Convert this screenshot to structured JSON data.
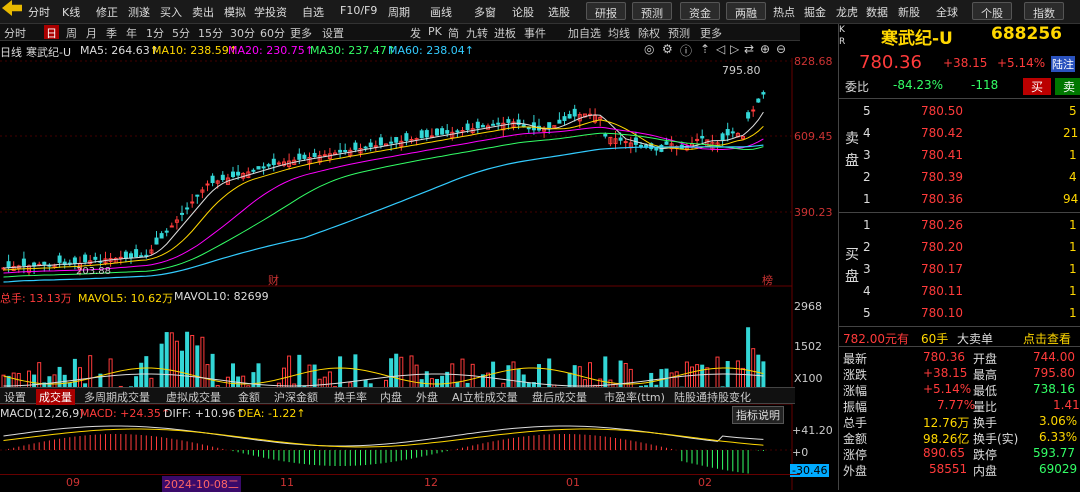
{
  "toolbar": {
    "left_items": [
      "分时",
      "K线",
      "修正",
      "测遂",
      "买入",
      "卖出",
      "模拟",
      "学投资",
      "自选",
      "F10/F9",
      "周期",
      "画线",
      "多窗",
      "论股",
      "选股"
    ],
    "right_buttons": [
      "研报",
      "预测",
      "资金",
      "两融"
    ],
    "right_items": [
      "热点",
      "掘金",
      "龙虎",
      "数据",
      "新股",
      "全球"
    ],
    "far_right_buttons": [
      "个股",
      "指数"
    ]
  },
  "periods": {
    "items": [
      "分时",
      "日",
      "周",
      "月",
      "季",
      "年",
      "1分",
      "5分",
      "15分",
      "30分",
      "60分",
      "更多",
      "设置"
    ],
    "selected": "日",
    "right_items": [
      "发",
      "PK",
      "简",
      "九转",
      "进板",
      "事件",
      "加自选",
      "均线",
      "除权",
      "预测",
      "更多"
    ]
  },
  "ma": {
    "label": "日线",
    "name": "寒武纪-U",
    "ma5": "MA5: 264.63↑",
    "ma10": "MA10: 238.59↑",
    "ma20": "MA20: 230.75↑",
    "ma30": "MA30: 237.47↑",
    "ma60": "MA60: 238.04↑"
  },
  "price_axis": [
    "828.68",
    "609.45",
    "390.23"
  ],
  "annotations": {
    "high": "795.80",
    "low": "203.88",
    "cai": "财",
    "bang": "榜"
  },
  "volume": {
    "label_total": "总手: 13.13万",
    "mavol5": "MAVOL5: 10.62万",
    "mavol10": "MAVOL10: 82699",
    "axis": [
      "2968",
      "1502",
      "X100"
    ]
  },
  "tabs": {
    "items": [
      "设置",
      "成交量",
      "多周期成交量",
      "虚拟成交量",
      "金额",
      "沪深金额",
      "换手率",
      "内盘",
      "外盘",
      "AI立桩成交量",
      "盘后成交量",
      "市盈率(ttm)",
      "陆股通持股变化"
    ],
    "selected": "成交量"
  },
  "macd": {
    "label": "MACD(12,26,9)",
    "value": "MACD: +24.35↑",
    "diff": "DIFF: +10.96↑",
    "dea": "DEA: -1.22↑",
    "help": "指标说明",
    "axis": [
      "+41.20",
      "+0",
      "-30.46"
    ]
  },
  "dates": [
    "09",
    "2024-10-08二",
    "11",
    "12",
    "01",
    "02"
  ],
  "quote": {
    "name": "寒武纪-U",
    "code": "688256",
    "price": "780.36",
    "change": "+38.15",
    "pct": "+5.14%",
    "tag": "陆注",
    "weibi_label": "委比",
    "weibi": "-84.23%",
    "weicha": "-118",
    "buy_btn": "买",
    "sell_btn": "卖",
    "sell_side_label": "卖盘",
    "buy_side_label": "买盘",
    "asks": [
      {
        "lvl": "5",
        "price": "780.50",
        "vol": "5"
      },
      {
        "lvl": "4",
        "price": "780.42",
        "vol": "21"
      },
      {
        "lvl": "3",
        "price": "780.41",
        "vol": "1"
      },
      {
        "lvl": "2",
        "price": "780.39",
        "vol": "4"
      },
      {
        "lvl": "1",
        "price": "780.36",
        "vol": "94"
      }
    ],
    "bids": [
      {
        "lvl": "1",
        "price": "780.26",
        "vol": "1"
      },
      {
        "lvl": "2",
        "price": "780.20",
        "vol": "1"
      },
      {
        "lvl": "3",
        "price": "780.17",
        "vol": "1"
      },
      {
        "lvl": "4",
        "price": "780.11",
        "vol": "1"
      },
      {
        "lvl": "5",
        "price": "780.10",
        "vol": "1"
      }
    ],
    "bigorder": "782.00元有",
    "bigorder_hands": "60手",
    "bigorder_type": "大卖单",
    "bigorder_link": "点击查看",
    "stats": [
      {
        "k": "最新",
        "v": "780.36",
        "k2": "开盘",
        "v2": "744.00"
      },
      {
        "k": "涨跌",
        "v": "+38.15",
        "k2": "最高",
        "v2": "795.80"
      },
      {
        "k": "涨幅",
        "v": "+5.14%",
        "k2": "最低",
        "v2": "738.16"
      },
      {
        "k": "振幅",
        "v": "7.77%",
        "k2": "量比",
        "v2": "1.41"
      },
      {
        "k": "总手",
        "v": "12.76万",
        "k2": "换手",
        "v2": "3.06%"
      },
      {
        "k": "金额",
        "v": "98.26亿",
        "k2": "换手(实)",
        "v2": "6.33%"
      },
      {
        "k": "涨停",
        "v": "890.65",
        "k2": "跌停",
        "v2": "593.77"
      },
      {
        "k": "外盘",
        "v": "58551",
        "k2": "内盘",
        "v2": "69029"
      }
    ]
  },
  "colors": {
    "up": "#ff3b3b",
    "down": "#33ff66",
    "flat": "#ddd",
    "ma5": "#ddd",
    "ma10": "#ffd700",
    "ma20": "#ff00ff",
    "ma30": "#33ff66",
    "ma60": "#3cf"
  }
}
